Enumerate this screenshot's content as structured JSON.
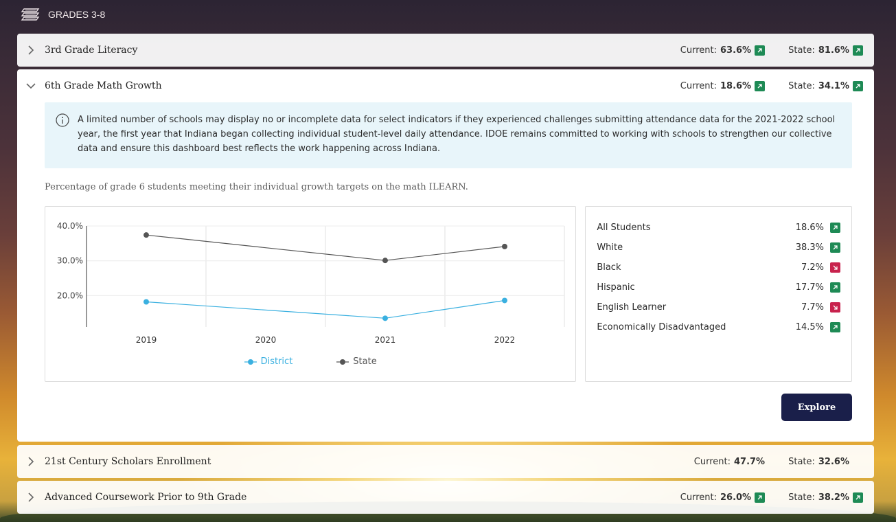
{
  "section": {
    "title": "GRADES 3-8",
    "icon": "stacked-books-icon"
  },
  "labels": {
    "current": "Current:",
    "state": "State:"
  },
  "colors": {
    "up": "#1e8a55",
    "down": "#c8224d",
    "district": "#3ab0e0",
    "state": "#555555",
    "button": "#1a1f4a"
  },
  "rows": [
    {
      "title": "3rd Grade Literacy",
      "current": "63.6%",
      "current_trend": "up",
      "state": "81.6%",
      "state_trend": "up",
      "expanded": false
    },
    {
      "title": "6th Grade Math Growth",
      "current": "18.6%",
      "current_trend": "up",
      "state": "34.1%",
      "state_trend": "up",
      "expanded": true,
      "notice": "A limited number of schools may display no or incomplete data for select indicators if they experienced challenges submitting attendance data for the 2021-2022 school year, the first year that Indiana began collecting individual student-level daily attendance. IDOE remains committed to working with schools to strengthen our collective data and ensure this dashboard best reflects the work happening across Indiana.",
      "description": "Percentage of grade 6 students meeting their individual growth targets on the math ILEARN.",
      "groups": [
        {
          "label": "All Students",
          "value": "18.6%",
          "trend": "up"
        },
        {
          "label": "White",
          "value": "38.3%",
          "trend": "up"
        },
        {
          "label": "Black",
          "value": "7.2%",
          "trend": "down"
        },
        {
          "label": "Hispanic",
          "value": "17.7%",
          "trend": "up"
        },
        {
          "label": "English Learner",
          "value": "7.7%",
          "trend": "down"
        },
        {
          "label": "Economically Disadvantaged",
          "value": "14.5%",
          "trend": "up"
        }
      ],
      "button": "Explore"
    },
    {
      "title": "21st Century Scholars Enrollment",
      "current": "47.7%",
      "current_trend": null,
      "state": "32.6%",
      "state_trend": null,
      "expanded": false
    },
    {
      "title": "Advanced Coursework Prior to 9th Grade",
      "current": "26.0%",
      "current_trend": "up",
      "state": "38.2%",
      "state_trend": "up",
      "expanded": false
    }
  ],
  "chart_data": {
    "type": "line",
    "categories": [
      "2019",
      "2020",
      "2021",
      "2022"
    ],
    "y_ticks": [
      "40.0%",
      "30.0%",
      "20.0%"
    ],
    "ylim": [
      11,
      40
    ],
    "grid": true,
    "legend_position": "bottom",
    "series": [
      {
        "name": "District",
        "color": "#3ab0e0",
        "values": [
          18.2,
          null,
          13.5,
          18.6
        ]
      },
      {
        "name": "State",
        "color": "#555555",
        "values": [
          37.4,
          null,
          30.1,
          34.1
        ]
      }
    ]
  }
}
